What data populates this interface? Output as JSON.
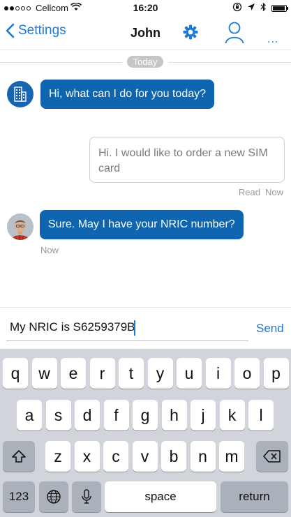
{
  "status_bar": {
    "carrier": "Cellcom",
    "time": "16:20",
    "signal_dots_filled": 2,
    "signal_dots_total": 5,
    "battery_level": 0.92
  },
  "nav": {
    "back_label": "Settings",
    "title": "John",
    "more_label": "...",
    "accent_color": "#1a7ad6"
  },
  "chat": {
    "date_label": "Today",
    "messages": [
      {
        "from": "bot",
        "text": "Hi, what can I do for you today?"
      },
      {
        "from": "me",
        "text": "Hi. I would like to order a new SIM card",
        "read_label": "Read",
        "time": "Now"
      },
      {
        "from": "agent",
        "text": "Sure. May I have your NRIC number?",
        "time": "Now"
      }
    ],
    "bubble_color": "#0f65b0"
  },
  "composer": {
    "value": "My NRIC is S6259379B",
    "send_label": "Send"
  },
  "keyboard": {
    "row1": [
      "q",
      "w",
      "e",
      "r",
      "t",
      "y",
      "u",
      "i",
      "o",
      "p"
    ],
    "row2": [
      "a",
      "s",
      "d",
      "f",
      "g",
      "h",
      "j",
      "k",
      "l"
    ],
    "row3": [
      "z",
      "x",
      "c",
      "v",
      "b",
      "n",
      "m"
    ],
    "numbers_label": "123",
    "space_label": "space",
    "return_label": "return"
  }
}
